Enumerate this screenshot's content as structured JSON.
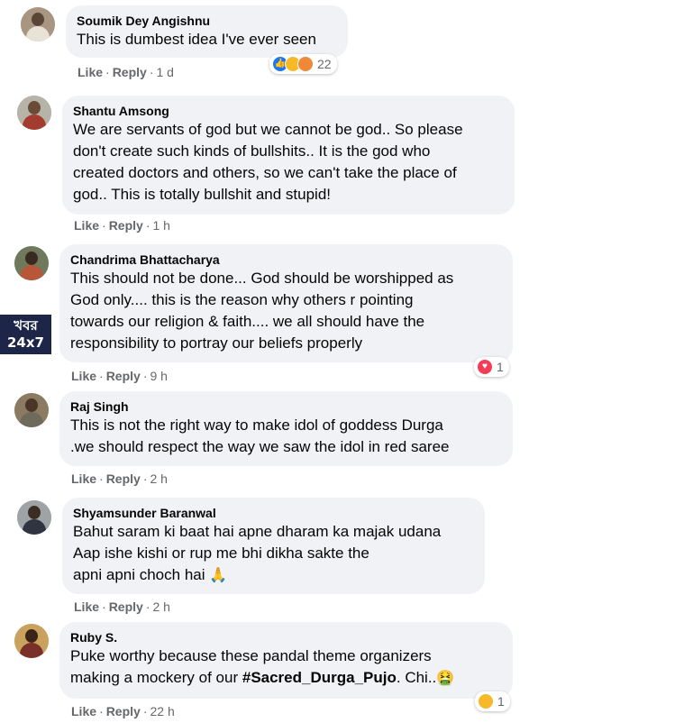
{
  "comments": [
    {
      "author": "Soumik Dey Angishnu",
      "text": "This is dumbest idea I've ever seen",
      "like": "Like",
      "reply": "Reply",
      "time": "1 d",
      "reaction_count": "22",
      "reactions": [
        "like-icon",
        "haha-icon",
        "angry-icon"
      ]
    },
    {
      "author": "Shantu Amsong",
      "text": "We are servants of god but we cannot be god.. So please\ndon't create such kinds of bullshits.. It is the god who\ncreated doctors and others, so we can't take the place of\ngod.. This is totally bullshit and stupid!",
      "like": "Like",
      "reply": "Reply",
      "time": "1 h"
    },
    {
      "author": "Chandrima Bhattacharya",
      "text": "This should not be done... God should be worshipped as\nGod only.... this is the reason why others r pointing\ntowards our religion & faith.... we all should have the\nresponsibility to portray our beliefs properly",
      "like": "Like",
      "reply": "Reply",
      "time": "9 h",
      "reaction_count": "1",
      "reactions": [
        "love-icon"
      ]
    },
    {
      "author": "Raj Singh",
      "text": "This is not the right way to make idol of goddess Durga\n.we should respect the way we saw the idol in red saree",
      "like": "Like",
      "reply": "Reply",
      "time": "2 h"
    },
    {
      "author": "Shyamsunder Baranwal",
      "text": "Bahut saram ki baat hai apne dharam ka majak udana\nAap ishe kishi or rup me bhi dikha sakte the\napni apni choch hai",
      "emoji": "🙏",
      "like": "Like",
      "reply": "Reply",
      "time": "2 h"
    },
    {
      "author": "Ruby S.",
      "text_before": "Puke worthy because these pandal theme organizers\nmaking a mockery of our ",
      "hashtag": "#Sacred_Durga_Pujo",
      "text_after": ". Chi..",
      "emoji": "🤮",
      "like": "Like",
      "reply": "Reply",
      "time": "22 h",
      "reaction_count": "1",
      "reactions": [
        "haha-icon"
      ]
    }
  ],
  "watermark": {
    "line1": "খবর",
    "line2": "24x7"
  },
  "colors": {
    "bubble": "#f0f2f5",
    "meta": "#65676b",
    "like_blue": "#1877f2",
    "love_red": "#f33e58",
    "haha_yellow": "#f7b928"
  }
}
